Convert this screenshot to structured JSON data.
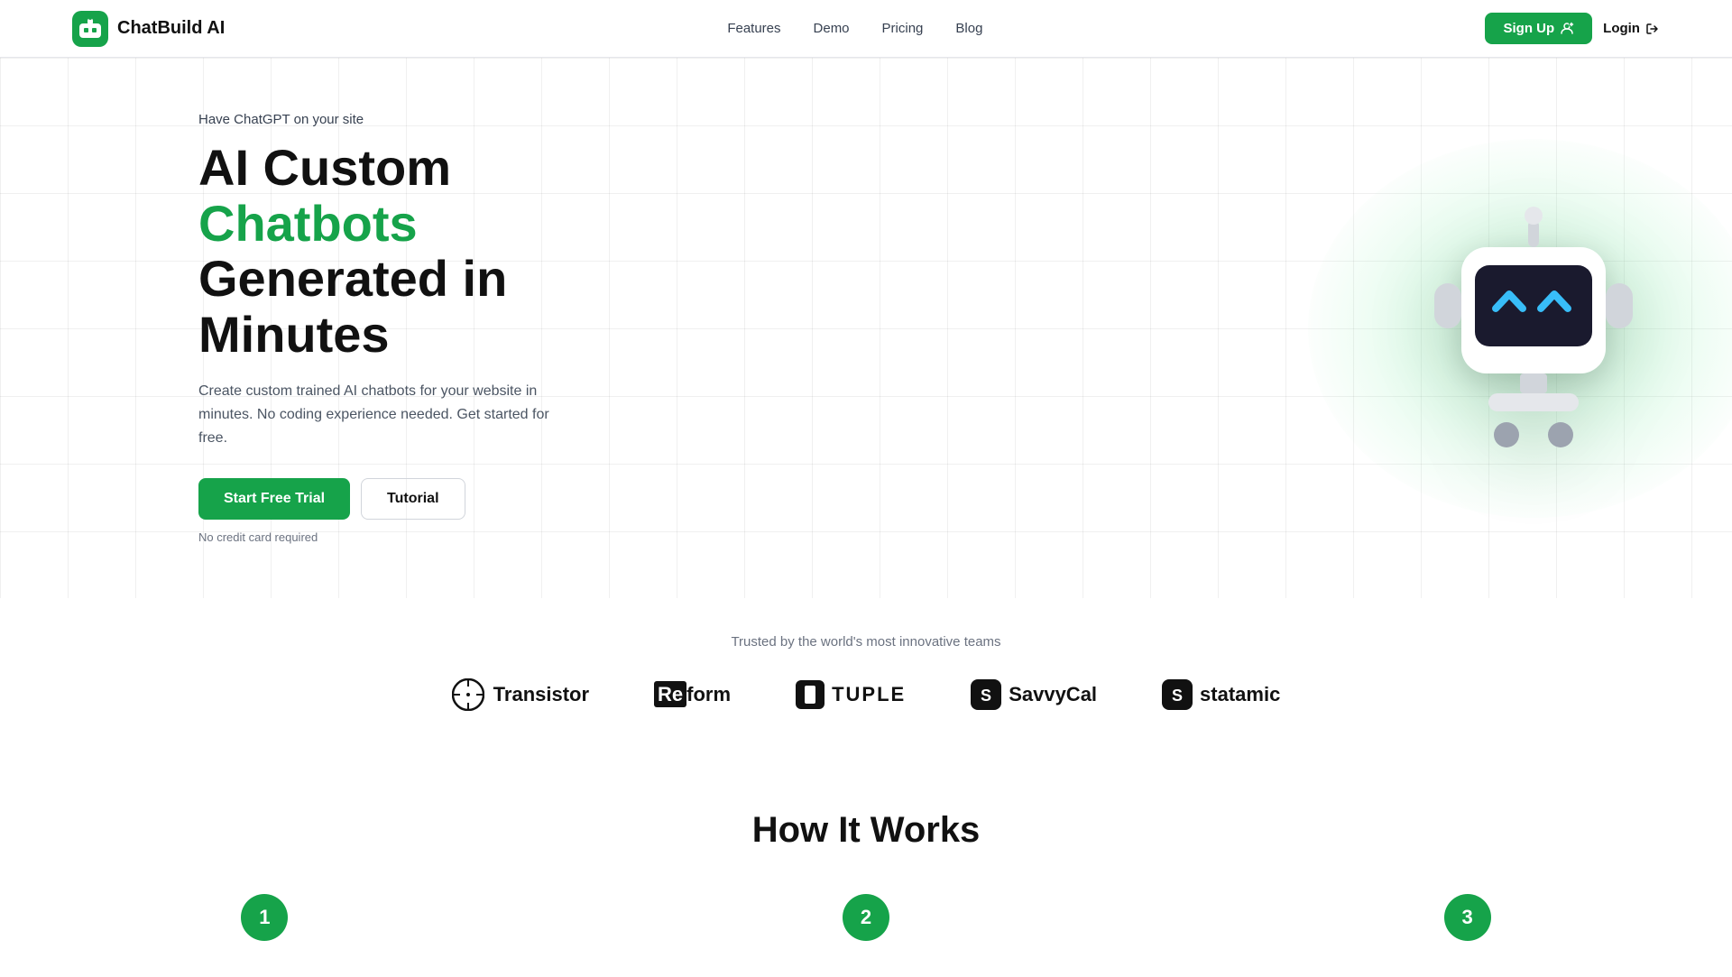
{
  "nav": {
    "brand": "ChatBuild AI",
    "links": [
      {
        "label": "Features",
        "href": "#"
      },
      {
        "label": "Demo",
        "href": "#"
      },
      {
        "label": "Pricing",
        "href": "#"
      },
      {
        "label": "Blog",
        "href": "#"
      }
    ],
    "signup_label": "Sign Up",
    "login_label": "Login"
  },
  "hero": {
    "eyebrow": "Have ChatGPT on your site",
    "title_black1": "AI Custom ",
    "title_green": "Chatbots",
    "title_black2": "Generated in Minutes",
    "description": "Create custom trained AI chatbots for your website in minutes. No coding experience needed. Get started for free.",
    "cta_primary": "Start Free Trial",
    "cta_secondary": "Tutorial",
    "no_credit": "No credit card required"
  },
  "trusted": {
    "label": "Trusted by the world's most innovative teams",
    "logos": [
      {
        "name": "Transistor",
        "type": "transistor"
      },
      {
        "name": "Reform",
        "type": "reform"
      },
      {
        "name": "TUPLE",
        "type": "tuple"
      },
      {
        "name": "SavvyCal",
        "type": "savvycal"
      },
      {
        "name": "statamic",
        "type": "statamic"
      }
    ]
  },
  "how_it_works": {
    "title": "How It Works",
    "steps": [
      {
        "number": "1"
      },
      {
        "number": "2"
      },
      {
        "number": "3"
      }
    ]
  },
  "colors": {
    "green": "#16a34a",
    "dark": "#111111"
  }
}
